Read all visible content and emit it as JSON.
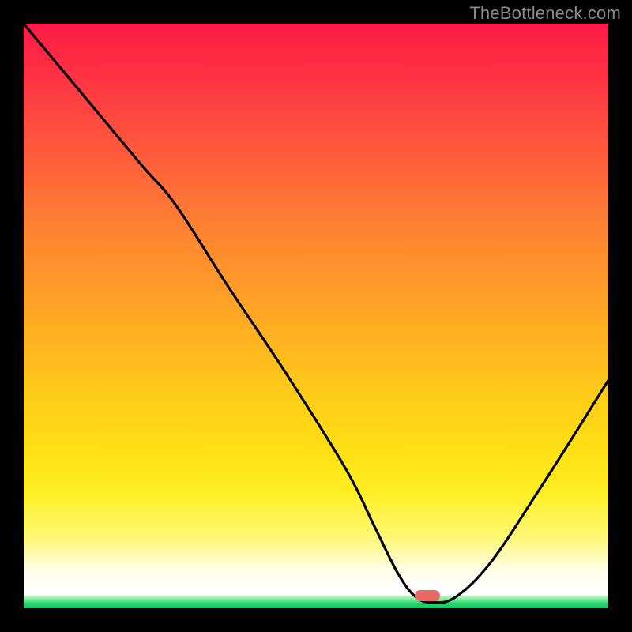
{
  "watermark": "TheBottleneck.com",
  "colors": {
    "background": "#000000",
    "curve": "#000000",
    "marker": "#e46a6a",
    "green_base": "#17c45e"
  },
  "chart_data": {
    "type": "line",
    "title": "",
    "xlabel": "",
    "ylabel": "",
    "xlim": [
      0,
      100
    ],
    "ylim": [
      0,
      100
    ],
    "grid": false,
    "series": [
      {
        "name": "bottleneck-curve",
        "x": [
          0,
          10,
          20,
          26,
          35,
          45,
          55,
          60,
          64,
          67,
          70,
          74,
          80,
          88,
          95,
          100
        ],
        "values": [
          100,
          88,
          76,
          69,
          55,
          40,
          24,
          14,
          6,
          2,
          1,
          2,
          8,
          20,
          31,
          39
        ]
      }
    ],
    "marker": {
      "x": 69,
      "y": 1.5,
      "bottleneck_percent": 0
    },
    "gradient_stops": [
      {
        "pos": 0.0,
        "color": "#ff1a47"
      },
      {
        "pos": 0.34,
        "color": "#ff7f33"
      },
      {
        "pos": 0.72,
        "color": "#ffdd14"
      },
      {
        "pos": 0.93,
        "color": "#fffde0"
      },
      {
        "pos": 0.98,
        "color": "#7de89a"
      },
      {
        "pos": 1.0,
        "color": "#17c45e"
      }
    ]
  }
}
